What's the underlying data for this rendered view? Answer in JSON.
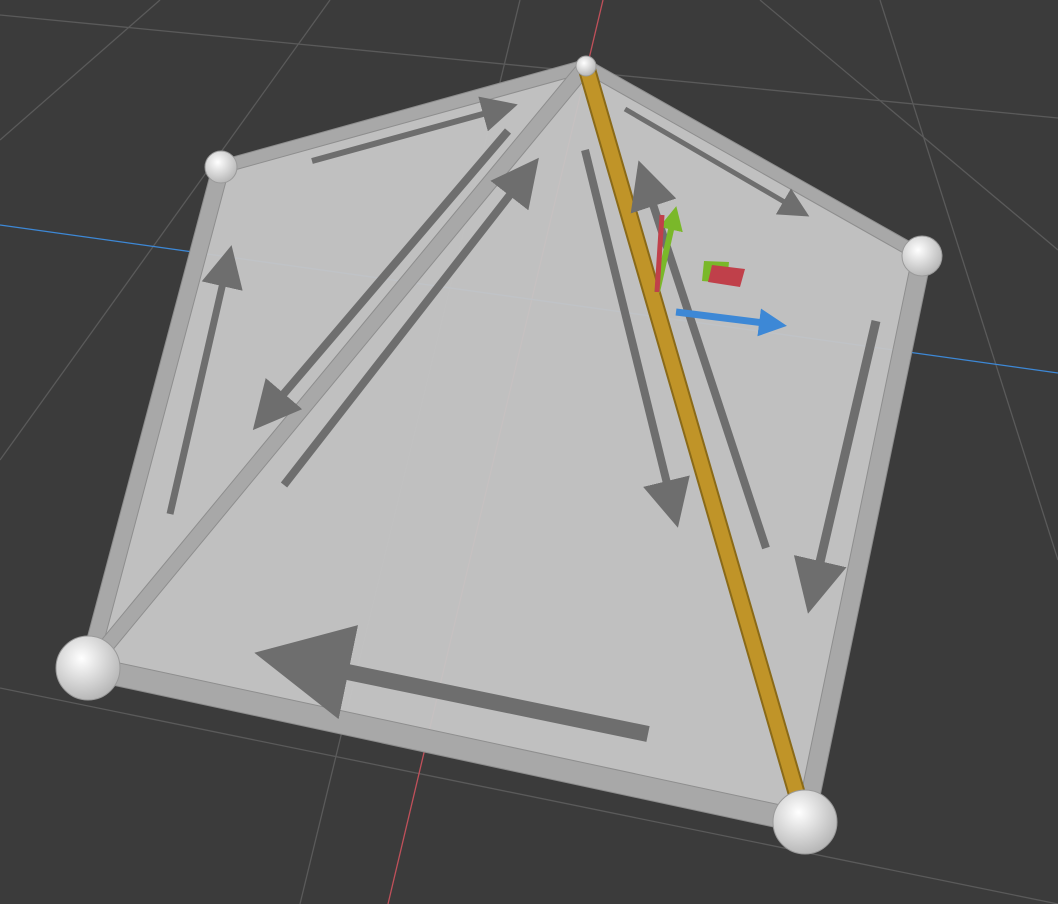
{
  "viewport": {
    "kind": "3d-mesh-editor-viewport",
    "background_color": "#3b3b3b",
    "grid_color": "#5a5a5a",
    "x_axis_color": "#c0505a",
    "z_axis_color": "#3d88d6"
  },
  "mesh": {
    "face_fill_color": "#c6c6c6",
    "edge_color": "#a8a8a8",
    "vertex_color": "#e4e4e4",
    "selected_edge_color": "#c09428",
    "half_edge_arrow_color": "#6e6e6e",
    "vertex_count": 5,
    "edge_count": 7,
    "face_count": 2,
    "selected_edge_count": 1
  },
  "gizmo": {
    "y_axis_color": "#7ab82a",
    "x_axis_color": "#c0404a",
    "z_axis_color": "#3d88d6",
    "plane_handle_colors": [
      "#7ab82a",
      "#c0404a"
    ]
  }
}
